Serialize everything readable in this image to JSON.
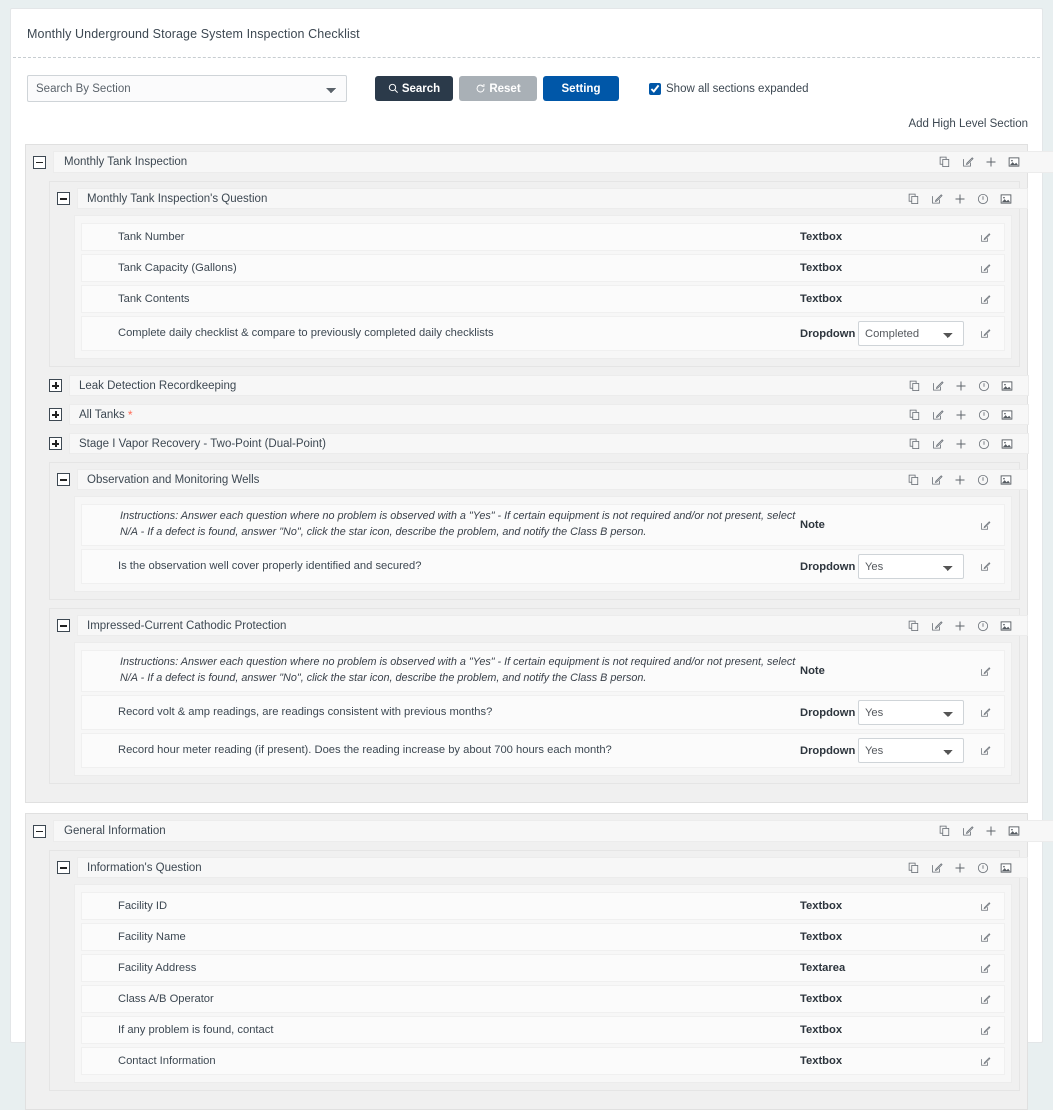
{
  "form": {
    "title": "Monthly Underground Storage System Inspection Checklist"
  },
  "toolbar": {
    "search_select_value": "Search By Section",
    "search_button": "Search",
    "reset_button": "Reset",
    "setting_button": "Setting",
    "expand_checkbox_label": "Show all sections expanded",
    "expand_checkbox_checked": true,
    "add_high_level_section": "Add High Level Section"
  },
  "icon_names": {
    "copy": "copy-icon",
    "edit": "edit-icon",
    "add": "plus-icon",
    "info": "info-circle-icon",
    "image": "image-icon",
    "row_edit": "row-edit-icon",
    "search": "search-icon",
    "reset": "reset-icon",
    "collapse": "collapse-toggle-icon",
    "expand": "expand-toggle-icon"
  },
  "colors": {
    "page_background": "#e8eff0",
    "card_background": "#ffffff",
    "search_button": "#2b3a4a",
    "reset_button": "#a9b0b6",
    "setting_button": "#0057a8",
    "required_star": "#ff6a55",
    "section_background": "#f0f0f0",
    "row_background": "#fbfbfb"
  },
  "sections": [
    {
      "title": "Monthly Tank Inspection",
      "expanded": true,
      "subsections": [
        {
          "title": "Monthly Tank Inspection's Question",
          "expanded": true,
          "required": false,
          "questions": [
            {
              "label": "Tank Number",
              "type": "Textbox",
              "value": null
            },
            {
              "label": "Tank Capacity (Gallons)",
              "type": "Textbox",
              "value": null
            },
            {
              "label": "Tank Contents",
              "type": "Textbox",
              "value": null
            },
            {
              "label": "Complete daily checklist & compare to previously completed daily checklists",
              "type": "Dropdown",
              "value": "Completed"
            }
          ]
        },
        {
          "title": "Leak Detection Recordkeeping",
          "expanded": false,
          "required": false,
          "questions": []
        },
        {
          "title": "All Tanks",
          "expanded": false,
          "required": true,
          "questions": []
        },
        {
          "title": "Stage I Vapor Recovery - Two-Point (Dual-Point)",
          "expanded": false,
          "required": false,
          "questions": []
        },
        {
          "title": "Observation and Monitoring Wells",
          "expanded": true,
          "required": false,
          "questions": [
            {
              "label": "Instructions: Answer each question where no problem is observed with a \"Yes\" - If certain equipment is not required and/or not present, select N/A - If a defect is found, answer \"No\", click the star icon, describe the problem, and notify the Class B person.",
              "type": "Note",
              "value": null,
              "note": true
            },
            {
              "label": "Is the observation well cover properly identified and secured?",
              "type": "Dropdown",
              "value": "Yes"
            }
          ]
        },
        {
          "title": "Impressed-Current Cathodic Protection",
          "expanded": true,
          "required": false,
          "questions": [
            {
              "label": "Instructions: Answer each question where no problem is observed with a \"Yes\" - If certain equipment is not required and/or not present, select N/A - If a defect is found, answer \"No\", click the star icon, describe the problem, and notify the Class B person.",
              "type": "Note",
              "value": null,
              "note": true
            },
            {
              "label": "Record volt & amp readings, are readings consistent with previous months?",
              "type": "Dropdown",
              "value": "Yes"
            },
            {
              "label": "Record hour meter reading (if present). Does the reading increase by about 700 hours each month?",
              "type": "Dropdown",
              "value": "Yes"
            }
          ]
        }
      ]
    },
    {
      "title": "General Information",
      "expanded": true,
      "subsections": [
        {
          "title": "Information's Question",
          "expanded": true,
          "required": false,
          "questions": [
            {
              "label": "Facility ID",
              "type": "Textbox",
              "value": null
            },
            {
              "label": "Facility Name",
              "type": "Textbox",
              "value": null
            },
            {
              "label": "Facility Address",
              "type": "Textarea",
              "value": null
            },
            {
              "label": "Class A/B Operator",
              "type": "Textbox",
              "value": null
            },
            {
              "label": "If any problem is found, contact",
              "type": "Textbox",
              "value": null
            },
            {
              "label": "Contact Information",
              "type": "Textbox",
              "value": null
            }
          ]
        }
      ]
    }
  ]
}
